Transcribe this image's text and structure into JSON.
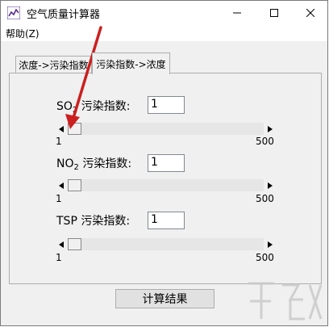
{
  "window": {
    "title": "空气质量计算器"
  },
  "menu": {
    "help": "帮助(Z)"
  },
  "tabs": [
    {
      "label": "浓度->污染指数",
      "active": false
    },
    {
      "label": "污染指数->浓度",
      "active": true
    }
  ],
  "pollutants": [
    {
      "name_main": "SO",
      "name_sub": "2",
      "suffix": "污染指数:",
      "value": "1",
      "min_label": "1",
      "max_label": "500",
      "slider_value": 1
    },
    {
      "name_main": "NO",
      "name_sub": "2",
      "suffix": "污染指数:",
      "value": "1",
      "min_label": "1",
      "max_label": "500",
      "slider_value": 1
    },
    {
      "name_main": "TSP",
      "name_sub": "",
      "suffix": "污染指数:",
      "value": "1",
      "min_label": "1",
      "max_label": "500",
      "slider_value": 1
    }
  ],
  "calculate_button": "计算结果",
  "colors": {
    "annotation_arrow": "#cc1f1f",
    "app_icon": "#5a2d8c"
  },
  "icons": [
    "app-chart-icon",
    "minimize-icon",
    "maximize-icon",
    "close-icon",
    "scroll-left-icon",
    "scroll-right-icon",
    "watermark-logo"
  ]
}
